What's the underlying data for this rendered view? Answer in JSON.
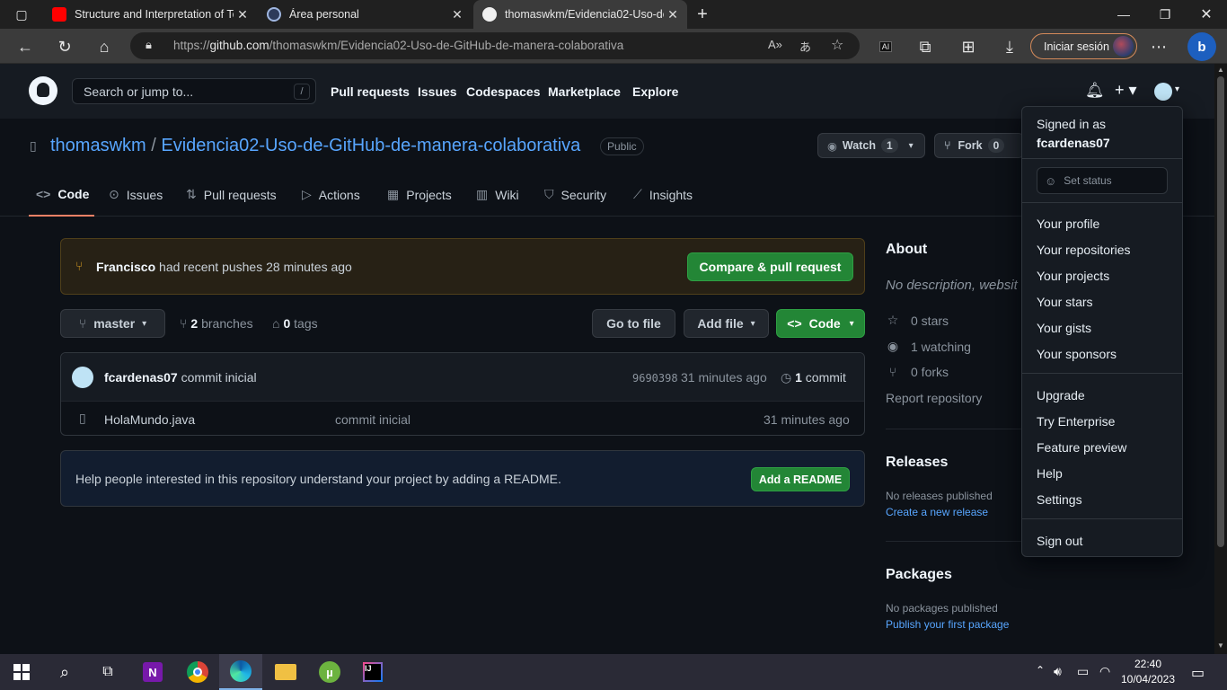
{
  "browser": {
    "tabs": [
      {
        "title": "Structure and Interpretation of Te",
        "icon": "youtube-icon",
        "active": false
      },
      {
        "title": "Área personal",
        "icon": "moodle-icon",
        "active": false
      },
      {
        "title": "thomaswkm/Evidencia02-Uso-de",
        "icon": "github-icon",
        "active": true
      }
    ],
    "url_prefix": "https://",
    "url_host": "github.com",
    "url_path": "/thomaswkm/Evidencia02-Uso-de-GitHub-de-manera-colaborativa",
    "signin_label": "Iniciar sesión",
    "new_tab": "+",
    "ai_badge": "AI"
  },
  "gh_header": {
    "search_placeholder": "Search or jump to...",
    "search_shortcut": "/",
    "nav": [
      "Pull requests",
      "Issues",
      "Codespaces",
      "Marketplace",
      "Explore"
    ]
  },
  "repo": {
    "owner": "thomaswkm",
    "separator": " / ",
    "name": "Evidencia02-Uso-de-GitHub-de-manera-colaborativa",
    "visibility": "Public",
    "watch_label": "Watch",
    "watch_count": "1",
    "fork_label": "Fork",
    "fork_count": "0"
  },
  "repo_tabs": [
    "Code",
    "Issues",
    "Pull requests",
    "Actions",
    "Projects",
    "Wiki",
    "Security",
    "Insights"
  ],
  "push_banner": {
    "user": "Francisco",
    "text": " had recent pushes 28 minutes ago",
    "button": "Compare & pull request"
  },
  "branch_bar": {
    "branch": "master",
    "branch_count": "2",
    "branches_label": "branches",
    "tag_count": "0",
    "tags_label": "tags",
    "go_to_file": "Go to file",
    "add_file": "Add file",
    "code": "Code"
  },
  "latest_commit": {
    "author": "fcardenas07",
    "message": "commit inicial",
    "sha": "9690398",
    "time": "31 minutes ago",
    "commit_count": "1",
    "commit_label": "commit"
  },
  "files": [
    {
      "name": "HolaMundo.java",
      "message": "commit inicial",
      "time": "31 minutes ago"
    }
  ],
  "readme_prompt": {
    "text": "Help people interested in this repository understand your project by adding a README.",
    "button": "Add a README"
  },
  "about": {
    "title": "About",
    "description": "No description, websit",
    "stars": "0 stars",
    "watching": "1 watching",
    "forks": "0 forks",
    "report": "Report repository"
  },
  "releases": {
    "title": "Releases",
    "empty": "No releases published",
    "link": "Create a new release"
  },
  "packages": {
    "title": "Packages",
    "empty": "No packages published",
    "link": "Publish your first package"
  },
  "user_menu": {
    "signed_in_as": "Signed in as",
    "username": "fcardenas07",
    "set_status": "Set status",
    "group1": [
      "Your profile",
      "Your repositories",
      "Your projects",
      "Your stars",
      "Your gists",
      "Your sponsors"
    ],
    "group2": [
      "Upgrade",
      "Try Enterprise",
      "Feature preview",
      "Help",
      "Settings"
    ],
    "sign_out": "Sign out"
  },
  "taskbar": {
    "time": "22:40",
    "date": "10/04/2023",
    "apps": [
      "start-icon",
      "search-icon",
      "task-view-icon",
      "onenote-icon",
      "chrome-icon",
      "edge-icon",
      "file-explorer-icon",
      "utorrent-icon",
      "intellij-icon"
    ]
  },
  "colors": {
    "accent_link": "#58a6ff",
    "green_button": "#238636",
    "tab_underline": "#f78166"
  }
}
